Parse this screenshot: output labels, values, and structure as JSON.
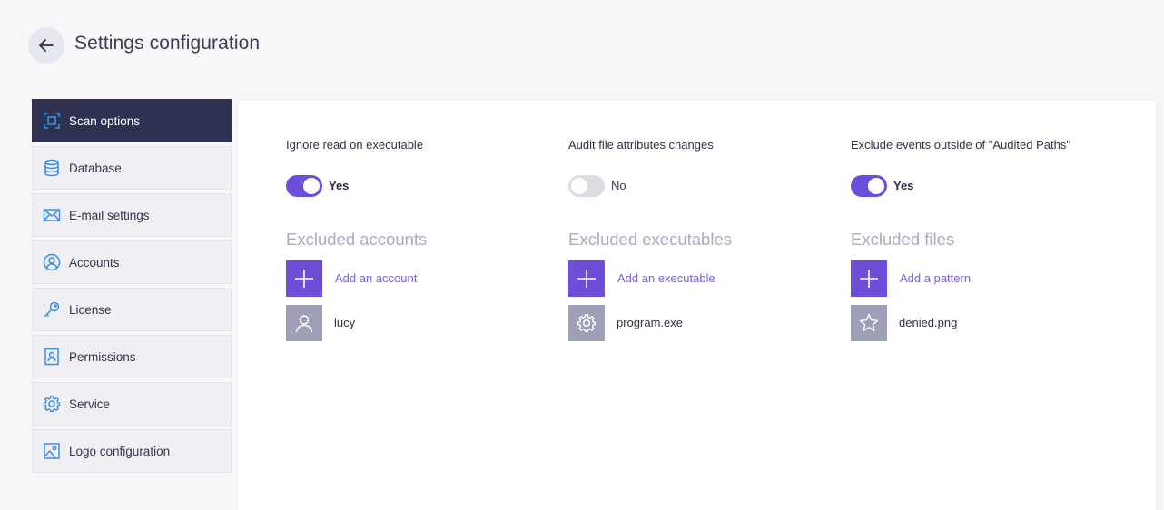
{
  "header": {
    "title": "Settings configuration"
  },
  "sidebar": {
    "items": [
      {
        "label": "Scan options",
        "icon": "scan-icon",
        "active": true
      },
      {
        "label": "Database",
        "icon": "database-icon",
        "active": false
      },
      {
        "label": "E-mail settings",
        "icon": "envelope-icon",
        "active": false
      },
      {
        "label": "Accounts",
        "icon": "user-circle-icon",
        "active": false
      },
      {
        "label": "License",
        "icon": "key-icon",
        "active": false
      },
      {
        "label": "Permissions",
        "icon": "badge-icon",
        "active": false
      },
      {
        "label": "Service",
        "icon": "gear-icon",
        "active": false
      },
      {
        "label": "Logo configuration",
        "icon": "image-icon",
        "active": false
      }
    ]
  },
  "main": {
    "columns": [
      {
        "setting_label": "Ignore read on executable",
        "toggle_on": true,
        "toggle_text": "Yes",
        "section_title": "Excluded accounts",
        "add_label": "Add an account",
        "items": [
          {
            "label": "lucy",
            "icon": "user-icon"
          }
        ]
      },
      {
        "setting_label": "Audit file attributes changes",
        "toggle_on": false,
        "toggle_text": "No",
        "section_title": "Excluded executables",
        "add_label": "Add an executable",
        "items": [
          {
            "label": "program.exe",
            "icon": "gear-icon"
          }
        ]
      },
      {
        "setting_label": "Exclude events outside of \"Audited Paths\"",
        "toggle_on": true,
        "toggle_text": "Yes",
        "section_title": "Excluded files",
        "add_label": "Add a pattern",
        "items": [
          {
            "label": "denied.png",
            "icon": "star-icon"
          }
        ]
      }
    ]
  },
  "colors": {
    "accent": "#6d4ed8",
    "sidebar_active": "#2e3150",
    "icon_blue": "#3a8ee6",
    "item_icon_bg": "#9da0b7"
  }
}
